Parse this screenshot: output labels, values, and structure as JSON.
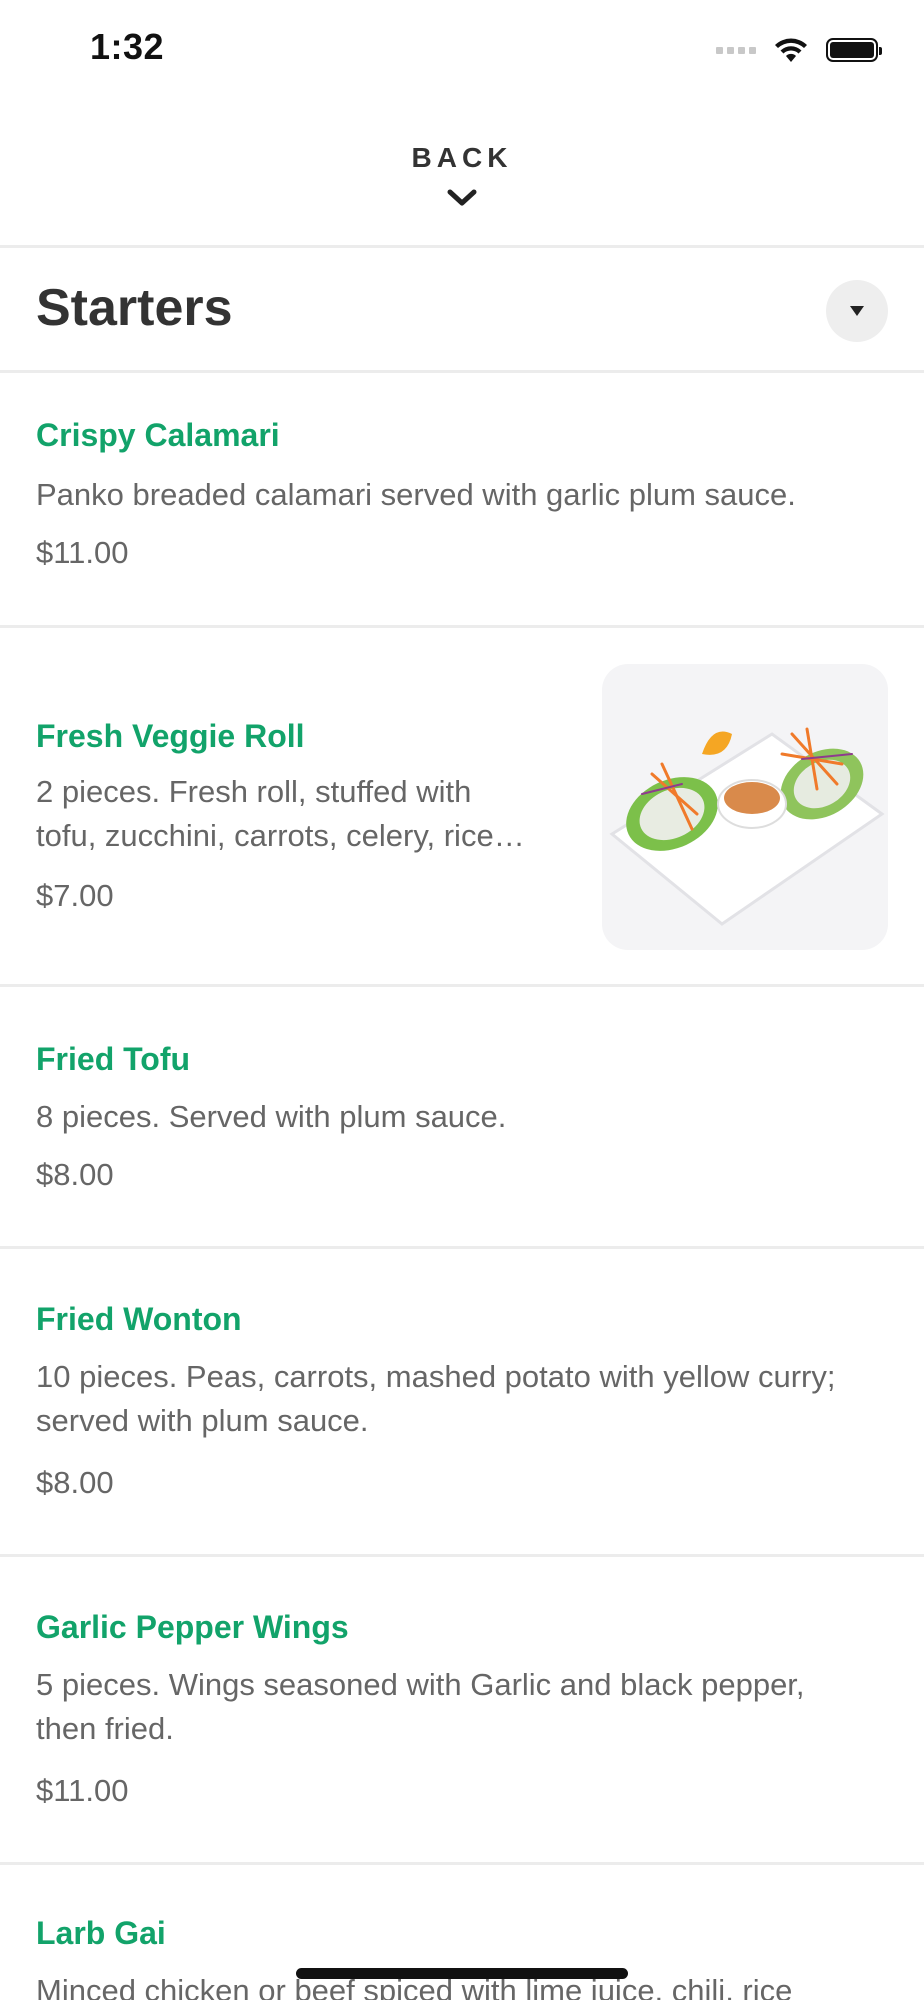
{
  "status": {
    "time": "1:32"
  },
  "nav": {
    "back_label": "BACK"
  },
  "section": {
    "title": "Starters"
  },
  "items": [
    {
      "name": "Crispy Calamari",
      "description": "Panko breaded calamari served with garlic plum sauce.",
      "price": "$11.00"
    },
    {
      "name": "Fresh Veggie Roll",
      "description_line1": "2 pieces. Fresh roll, stuffed with",
      "description_line2": "tofu, zucchini, carrots, celery, rice…",
      "price": "$7.00"
    },
    {
      "name": "Fried Tofu",
      "description": "8 pieces. Served with plum sauce.",
      "price": "$8.00"
    },
    {
      "name": "Fried Wonton",
      "description_line1": "10 pieces. Peas, carrots, mashed potato with yellow curry;",
      "description_line2": "served with plum sauce.",
      "price": "$8.00"
    },
    {
      "name": "Garlic Pepper Wings",
      "description_line1": "5 pieces. Wings seasoned with Garlic and black pepper,",
      "description_line2": "then fried.",
      "price": "$11.00"
    },
    {
      "name": "Larb Gai",
      "description": "Minced chicken or beef spiced with lime juice, chili, rice"
    }
  ],
  "colors": {
    "item_name": "#12a36a",
    "text_muted": "#666666",
    "divider": "#ececec"
  }
}
